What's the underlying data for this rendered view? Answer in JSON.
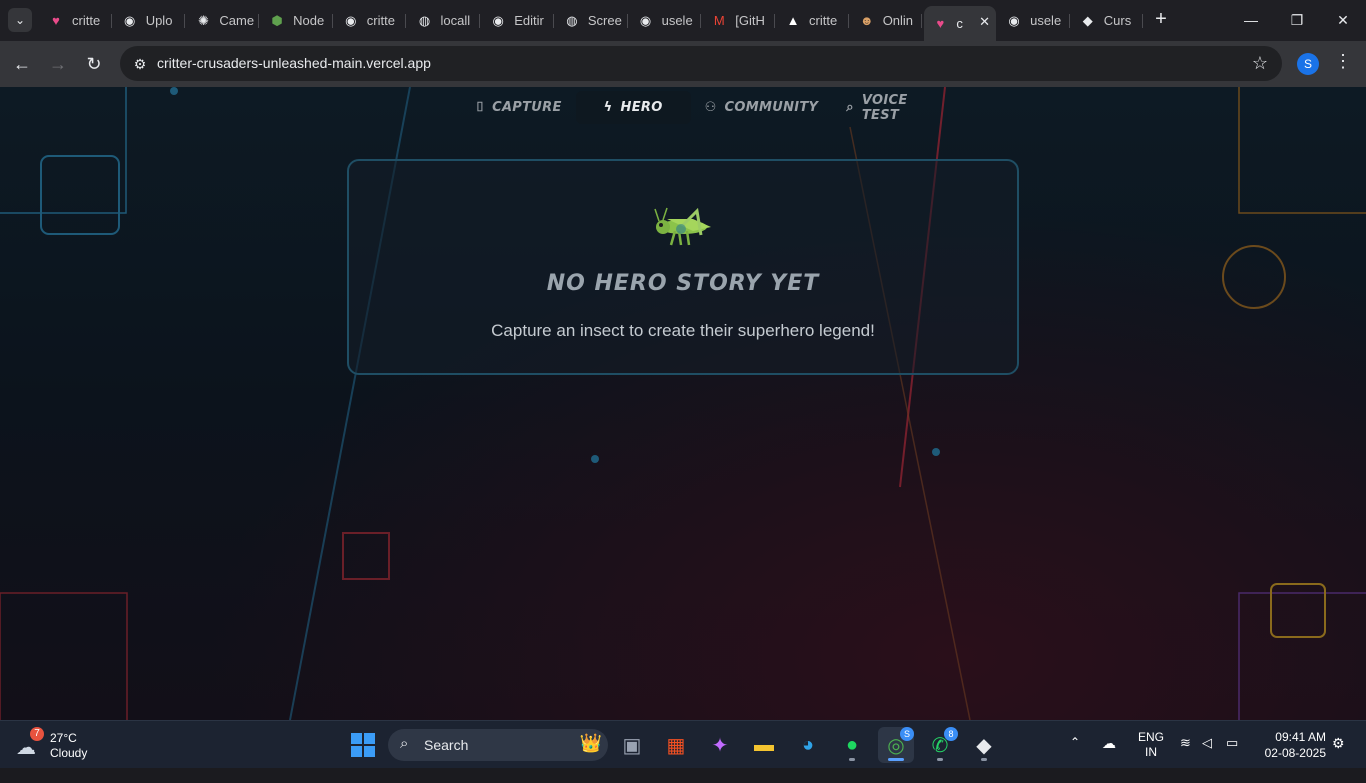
{
  "browser": {
    "tabs": [
      {
        "label": "critte",
        "icon": "lovable-icon"
      },
      {
        "label": "Uplo",
        "icon": "github-icon"
      },
      {
        "label": "Came",
        "icon": "chatgpt-icon"
      },
      {
        "label": "Node",
        "icon": "node-icon"
      },
      {
        "label": "critte",
        "icon": "github-icon"
      },
      {
        "label": "locall",
        "icon": "globe-icon"
      },
      {
        "label": "Editir",
        "icon": "github-icon"
      },
      {
        "label": "Scree",
        "icon": "globe-icon"
      },
      {
        "label": "usele",
        "icon": "github-icon"
      },
      {
        "label": "[GitH",
        "icon": "gmail-icon"
      },
      {
        "label": "critte",
        "icon": "vercel-icon"
      },
      {
        "label": "Onlin",
        "icon": "avatar-icon"
      },
      {
        "label": "c",
        "icon": "lovable-icon",
        "active": true
      },
      {
        "label": "usele",
        "icon": "github-icon"
      },
      {
        "label": "Curs",
        "icon": "cursor-icon"
      }
    ],
    "url": "critter-crusaders-unleashed-main.vercel.app",
    "profile_initial": "S",
    "accent": "#1a73e8"
  },
  "nav": {
    "items": [
      {
        "label": "CAPTURE",
        "icon": "camera-icon"
      },
      {
        "label": "HERO",
        "icon": "lightning-icon",
        "active": true
      },
      {
        "label": "COMMUNITY",
        "icon": "users-icon"
      },
      {
        "label": "VOICE TEST",
        "icon": "microphone-icon"
      }
    ]
  },
  "card": {
    "icon": "grasshopper-icon",
    "title": "NO HERO STORY YET",
    "text": "Capture an insect to create their superhero legend!"
  },
  "taskbar": {
    "weather": {
      "badge": "7",
      "temp": "27°C",
      "desc": "Cloudy"
    },
    "search_label": "Search",
    "apps": [
      {
        "name": "task-view",
        "icon": "task-view-icon"
      },
      {
        "name": "store",
        "icon": "store-icon"
      },
      {
        "name": "copilot",
        "icon": "copilot-icon"
      },
      {
        "name": "file-explorer",
        "icon": "folder-icon"
      },
      {
        "name": "edge",
        "icon": "edge-icon"
      },
      {
        "name": "spotify",
        "icon": "spotify-icon"
      },
      {
        "name": "chrome",
        "icon": "chrome-icon",
        "active": true,
        "badge": "S"
      },
      {
        "name": "whatsapp",
        "icon": "whatsapp-icon",
        "badge": "8"
      },
      {
        "name": "cursor",
        "icon": "cursor-icon"
      }
    ],
    "tray": {
      "lang": "ENG",
      "region": "IN",
      "time": "09:41 AM",
      "date": "02-08-2025"
    }
  }
}
